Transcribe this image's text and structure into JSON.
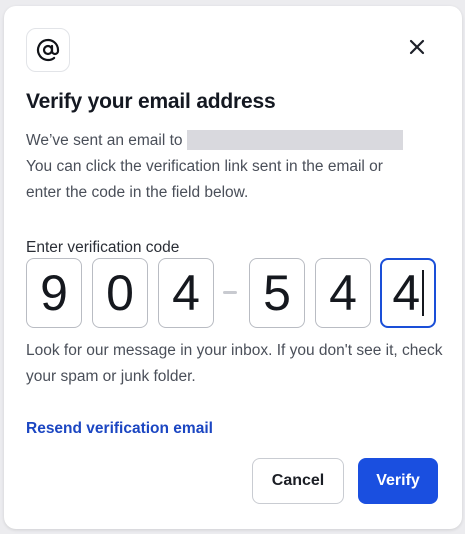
{
  "dialog": {
    "title": "Verify your email address",
    "sent_prefix": "We’ve sent an email to",
    "instruction_line1": "You can click the verification link sent in the email or",
    "instruction_line2": "enter the code in the field below.",
    "code_label": "Enter verification code",
    "code_digits": [
      "9",
      "0",
      "4",
      "5",
      "4",
      "4"
    ],
    "hint": "Look for our message in your inbox. If you don't see it, check your spam or junk folder.",
    "resend_label": "Resend verification email",
    "cancel_label": "Cancel",
    "verify_label": "Verify"
  },
  "icons": {
    "brand": "at-sign-icon",
    "close": "close-icon"
  },
  "colors": {
    "primary": "#1a4fe0",
    "link": "#1b46c2",
    "active_border": "#1a4fd8",
    "text": "#141821",
    "muted_text": "#4a4f59"
  }
}
